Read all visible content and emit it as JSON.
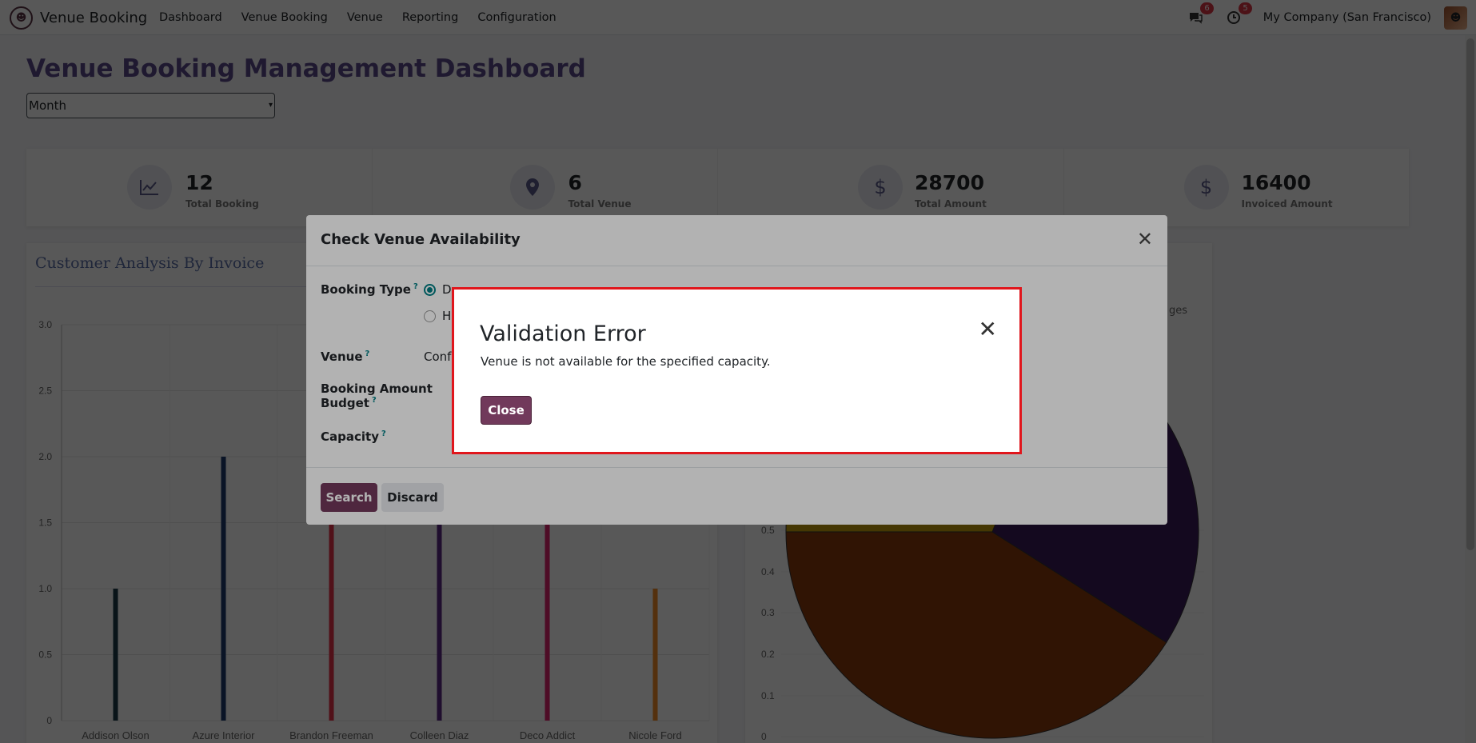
{
  "navbar": {
    "app_name": "Venue Booking",
    "menu": [
      "Dashboard",
      "Venue Booking",
      "Venue",
      "Reporting",
      "Configuration"
    ],
    "messages_count": "6",
    "activities_count": "5",
    "company": "My Company (San Francisco)"
  },
  "dashboard": {
    "title": "Venue Booking Management Dashboard",
    "period": "Month",
    "stats": [
      {
        "value": "12",
        "label": "Total Booking",
        "icon": "chart-line-icon"
      },
      {
        "value": "6",
        "label": "Total Venue",
        "icon": "map-marker-icon"
      },
      {
        "value": "28700",
        "label": "Total Amount",
        "icon": "dollar-icon"
      },
      {
        "value": "16400",
        "label": "Invoiced Amount",
        "icon": "dollar-icon"
      }
    ],
    "customer_chart_title": "Customer Analysis By Invoice",
    "pie_legend_partial": "ges"
  },
  "chart_data": [
    {
      "type": "bar",
      "title": "Customer Analysis By Invoice",
      "categories": [
        "Addison Olson",
        "Azure Interior",
        "Brandon Freeman",
        "Colleen Diaz",
        "Deco Addict",
        "Nicole Ford"
      ],
      "values": [
        1,
        2,
        2,
        2,
        2,
        1
      ],
      "colors": [
        "#1b3a4b",
        "#1e3a6e",
        "#e8334a",
        "#5b2a86",
        "#e0246e",
        "#f28c28"
      ],
      "yticks": [
        "0",
        "0.5",
        "1.0",
        "1.5",
        "2.0",
        "2.5",
        "3.0"
      ],
      "ylim": [
        0,
        3
      ]
    },
    {
      "type": "pie",
      "yticks": [
        "0",
        "0.1",
        "0.2",
        "0.3",
        "0.4",
        "0.5"
      ],
      "colors": [
        "#8a3a0c",
        "#3c1a5b",
        "#c9a10a"
      ]
    }
  ],
  "modal": {
    "title": "Check Venue Availability",
    "booking_type_label": "Booking Type",
    "booking_type_options": [
      "D",
      "H"
    ],
    "venue_label": "Venue",
    "venue_value": "Conf",
    "budget_label_line1": "Booking Amount",
    "budget_label_line2": "Budget",
    "capacity_label": "Capacity",
    "search_label": "Search",
    "discard_label": "Discard"
  },
  "error_dialog": {
    "title": "Validation Error",
    "message": "Venue is not available for the specified capacity.",
    "close_label": "Close"
  }
}
